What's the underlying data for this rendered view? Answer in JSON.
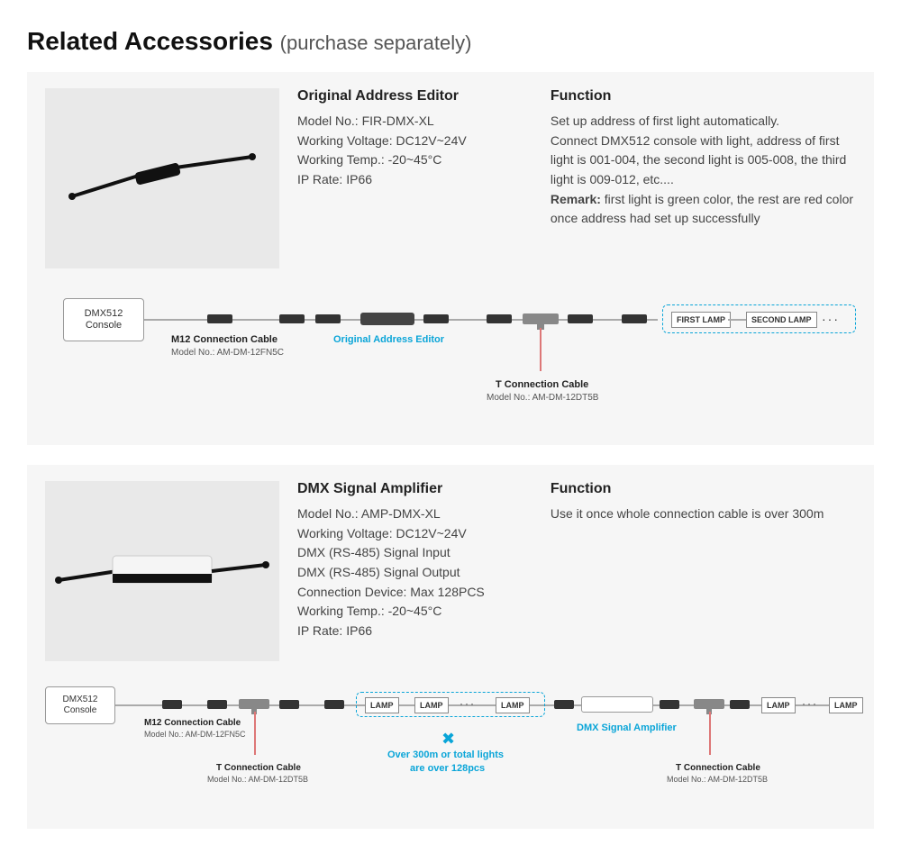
{
  "header": {
    "title": "Related Accessories",
    "subtitle": "(purchase separately)"
  },
  "product1": {
    "title": "Original Address Editor",
    "spec_model_label": "Model No.: FIR-DMX-XL",
    "spec_voltage": "Working Voltage: DC12V~24V",
    "spec_temp": "Working Temp.: -20~45°C",
    "spec_ip": "IP Rate: IP66",
    "function_title": "Function",
    "function_line1": "Set up address of first light automatically.",
    "function_line2": "Connect DMX512 console with light, address of first light is 001-004, the second light is 005-008, the third light is 009-012, etc....",
    "function_remark_label": "Remark:",
    "function_remark_text": " first light is green color, the rest are red color once address had set up successfully"
  },
  "product2": {
    "title": "DMX Signal Amplifier",
    "spec_model_label": "Model No.: AMP-DMX-XL",
    "spec_voltage": "Working Voltage: DC12V~24V",
    "spec_in": "DMX (RS-485) Signal Input",
    "spec_out": "DMX (RS-485) Signal Output",
    "spec_device": "Connection Device: Max 128PCS",
    "spec_temp": "Working Temp.: -20~45°C",
    "spec_ip": "IP Rate: IP66",
    "function_title": "Function",
    "function_text": "Use it once whole connection cable is over 300m"
  },
  "diagram": {
    "console": "DMX512\nConsole",
    "m12_label": "M12 Connection Cable",
    "m12_model": "Model No.: AM-DM-12FN5C",
    "editor_label": "Original Address Editor",
    "t_label": "T Connection Cable",
    "t_model": "Model No.: AM-DM-12DT5B",
    "first_lamp": "FIRST LAMP",
    "second_lamp": "SECOND LAMP",
    "lamp": "LAMP",
    "amp_label": "DMX Signal Amplifier",
    "over_label1": "Over 300m or total lights",
    "over_label2": "are over 128pcs"
  }
}
